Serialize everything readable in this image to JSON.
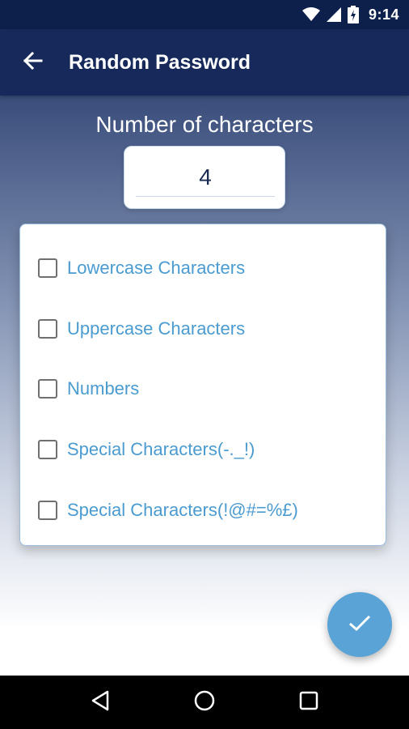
{
  "status_bar": {
    "time": "9:14",
    "icons": [
      "wifi-icon",
      "cell-signal-icon",
      "battery-charging-icon"
    ]
  },
  "app_bar": {
    "title": "Random Password",
    "back_icon": "arrow-left-icon"
  },
  "count": {
    "label": "Number of characters",
    "value": "4"
  },
  "options": [
    {
      "label": "Lowercase Characters",
      "checked": false
    },
    {
      "label": "Uppercase Characters",
      "checked": false
    },
    {
      "label": "Numbers",
      "checked": false
    },
    {
      "label": "Special Characters(-._!)",
      "checked": false
    },
    {
      "label": "Special Characters(!@#=%£)",
      "checked": false
    }
  ],
  "fab": {
    "icon": "check-icon"
  },
  "nav_bar": {
    "icons": [
      "back-triangle-icon",
      "home-circle-icon",
      "recents-square-icon"
    ]
  },
  "colors": {
    "status_bar": "#0d1f4b",
    "app_bar": "#16295a",
    "accent": "#4a9bd0",
    "fab": "#5aa3d6"
  }
}
